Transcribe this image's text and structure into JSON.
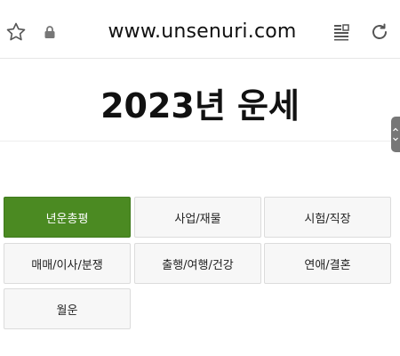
{
  "browser": {
    "url": "www.unsenuri.com",
    "icons": [
      "star-icon",
      "lock-icon",
      "reader-mode-icon",
      "reload-icon"
    ]
  },
  "page": {
    "title": "2023년 운세"
  },
  "menu": {
    "items": [
      {
        "label": "년운총평",
        "active": true
      },
      {
        "label": "사업/재물",
        "active": false
      },
      {
        "label": "시험/직장",
        "active": false
      },
      {
        "label": "매매/이사/분쟁",
        "active": false
      },
      {
        "label": "출행/여행/건강",
        "active": false
      },
      {
        "label": "연애/결혼",
        "active": false
      },
      {
        "label": "월운",
        "active": false
      }
    ]
  },
  "colors": {
    "active_button": "#4b8a22",
    "button_bg": "#f7f7f7",
    "border": "#dcdcdc"
  }
}
